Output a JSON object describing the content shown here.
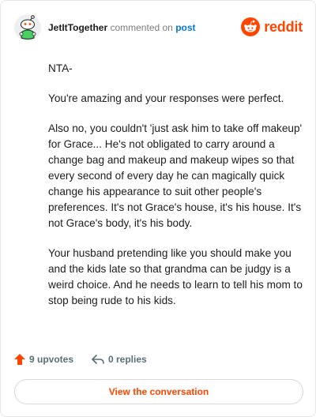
{
  "comment": {
    "username": "JetItTogether",
    "action_text": "commented on",
    "post_link_label": "post",
    "paragraphs": [
      "NTA-",
      "You're amazing and your responses were perfect.",
      "Also no, you couldn't 'just ask him to take off makeup' for Grace... He's not obligated to carry around a change bag and makeup and makeup wipes so that every second of every day he can magically quick change his appearance to suit other people's preferences. It's not Grace's house, it's his house. It's not Grace's body, it's his body.",
      "Your husband pretending like you should make you and the kids late so that grandma can be judgy is a weird choice. And he needs to learn to tell his mom to stop being rude to his kids."
    ]
  },
  "brand": {
    "wordmark": "reddit",
    "color": "#ff4500"
  },
  "footer": {
    "upvotes_label": "9 upvotes",
    "replies_label": "0 replies",
    "upvote_color": "#ff4500"
  },
  "cta": {
    "label": "View the conversation"
  }
}
